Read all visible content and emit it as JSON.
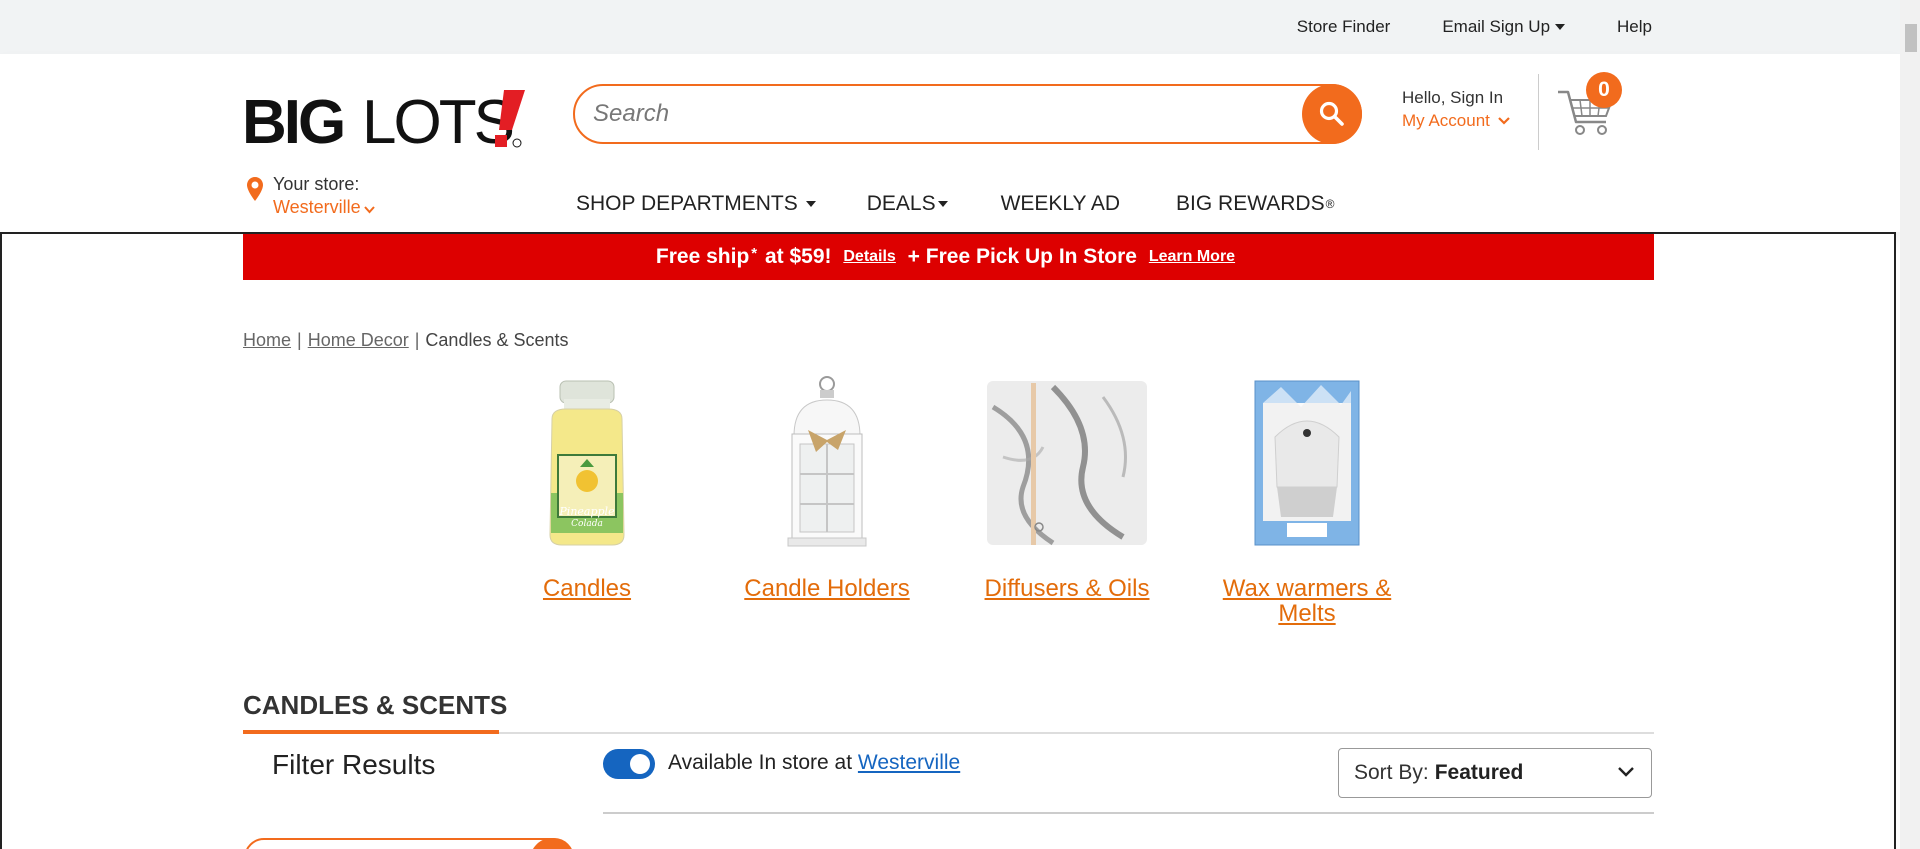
{
  "utility_bar": {
    "store_finder": "Store Finder",
    "email_sign_up": "Email Sign Up",
    "help": "Help"
  },
  "header": {
    "logo_text": "BIGLOTS!",
    "search_placeholder": "Search",
    "account_greeting": "Hello, Sign In",
    "account_link": "My Account",
    "cart_count": "0"
  },
  "store": {
    "label": "Your store:",
    "name": "Westerville"
  },
  "nav": {
    "shop_departments": "SHOP DEPARTMENTS",
    "deals": "DEALS",
    "weekly_ad": "WEEKLY AD",
    "big_rewards": "BIG REWARDS",
    "rewards_mark": "®"
  },
  "promo": {
    "part1": "Free ship",
    "asterisk": "*",
    "part2": " at $59! ",
    "details": "Details",
    "part3": " + Free Pick Up In Store ",
    "learn_more": "Learn More"
  },
  "breadcrumb": {
    "home": "Home",
    "home_decor": "Home Decor",
    "current": "Candles & Scents",
    "separator": "|"
  },
  "categories": [
    {
      "label": "Candles",
      "image": "candle-jar"
    },
    {
      "label": "Candle Holders",
      "image": "lantern"
    },
    {
      "label": "Diffusers & Oils",
      "image": "marble-diffuser"
    },
    {
      "label": "Wax warmers & Melts",
      "image": "wax-warmer-box"
    }
  ],
  "listing": {
    "title": "CANDLES & SCENTS",
    "filter_title": "Filter Results",
    "available_text": "Available In store at ",
    "available_store": "Westerville",
    "sort_prefix": "Sort By:",
    "sort_value": "Featured",
    "in_store_toggle_on": true
  },
  "colors": {
    "brand_orange": "#f26b1d",
    "promo_red": "#dd0000",
    "link_blue": "#1565c0",
    "category_link": "#e36c0a"
  }
}
